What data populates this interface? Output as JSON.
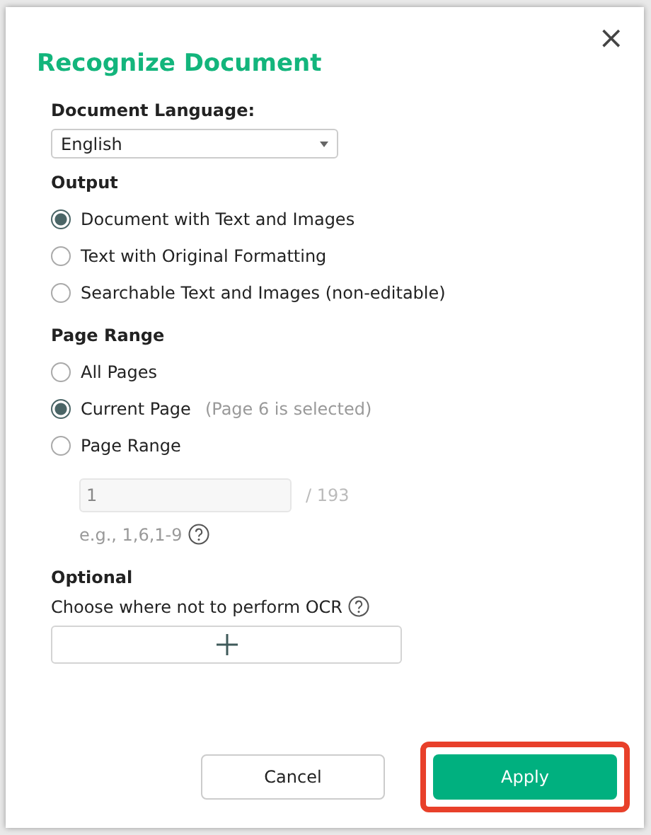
{
  "dialog": {
    "title": "Recognize Document",
    "close": "×"
  },
  "language": {
    "label": "Document Language:",
    "value": "English"
  },
  "output": {
    "label": "Output",
    "options": [
      {
        "label": "Document with Text and Images",
        "selected": true
      },
      {
        "label": "Text with Original Formatting",
        "selected": false
      },
      {
        "label": "Searchable Text and Images (non-editable)",
        "selected": false
      }
    ]
  },
  "page_range": {
    "label": "Page Range",
    "options": [
      {
        "label": "All Pages",
        "selected": false
      },
      {
        "label": "Current Page",
        "note": "(Page 6 is selected)",
        "selected": true
      },
      {
        "label": "Page Range",
        "selected": false
      }
    ],
    "range_field": {
      "value": "1",
      "disabled": true
    },
    "total": "/ 193",
    "hint": "e.g., 1,6,1-9"
  },
  "optional": {
    "label": "Optional",
    "description": "Choose where not to perform OCR"
  },
  "buttons": [
    {
      "label": "Cancel",
      "kind": "secondary",
      "highlighted": false
    },
    {
      "label": "Apply",
      "kind": "primary",
      "highlighted": true
    }
  ]
}
